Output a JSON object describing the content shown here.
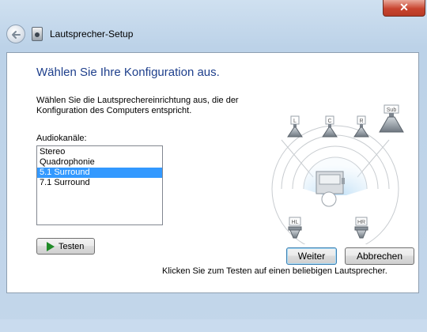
{
  "window": {
    "title": "Lautsprecher-Setup",
    "close_label": "✕"
  },
  "content": {
    "heading": "Wählen Sie Ihre Konfiguration aus.",
    "description": "Wählen Sie die Lautsprechereinrichtung aus, die der Konfiguration des Computers entspricht.",
    "channels_label": "Audiokanäle:",
    "channels": [
      {
        "label": "Stereo",
        "selected": false
      },
      {
        "label": "Quadrophonie",
        "selected": false
      },
      {
        "label": "5.1 Surround",
        "selected": true
      },
      {
        "label": "7.1 Surround",
        "selected": false
      }
    ],
    "test_button": "Testen",
    "hint": "Klicken Sie zum Testen auf einen beliebigen Lautsprecher."
  },
  "speakers": {
    "front_left": "L",
    "center": "C",
    "front_right": "R",
    "subwoofer": "Sub",
    "rear_left": "HL",
    "rear_right": "HR"
  },
  "footer": {
    "next_label": "Weiter",
    "cancel_label": "Abbrechen"
  },
  "colors": {
    "heading": "#1e3f8c",
    "selection": "#3399ff",
    "play_icon": "#1f8a27"
  }
}
